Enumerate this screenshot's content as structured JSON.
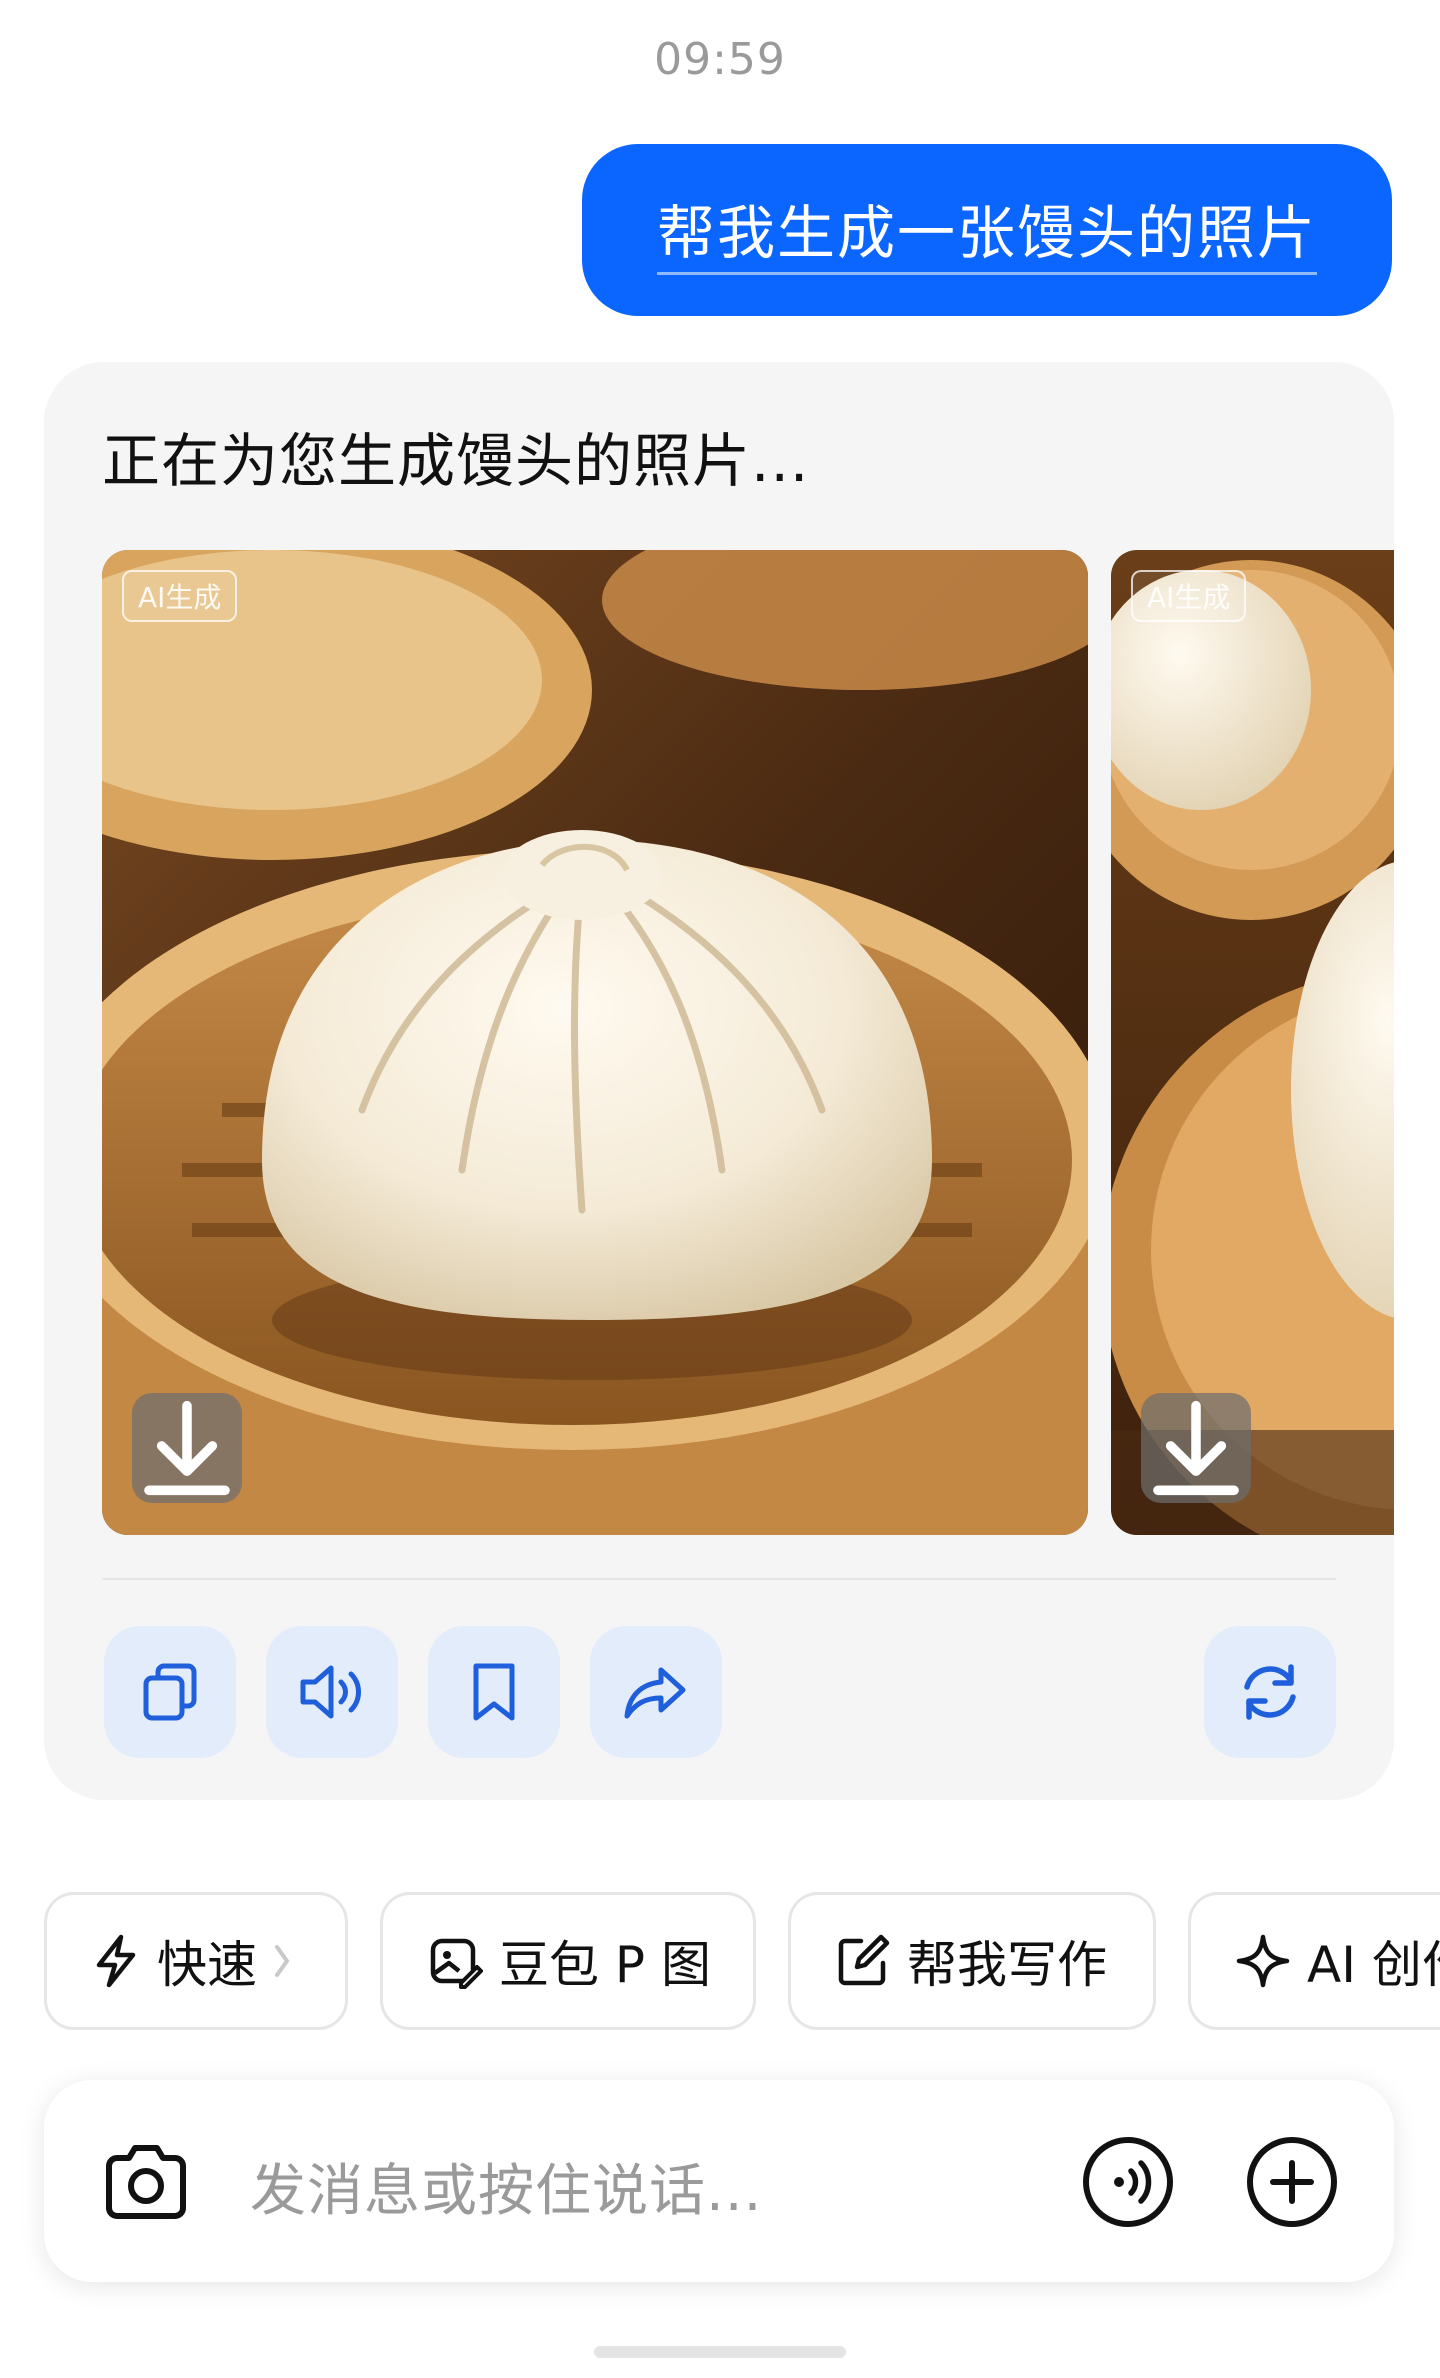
{
  "timestamp": "09:59",
  "user_message": "帮我生成一张馒头的照片",
  "ai_reply": {
    "text": "正在为您生成馒头的照片...",
    "images": [
      {
        "tag": "AI生成",
        "icon": "download-icon"
      },
      {
        "tag": "AI生成",
        "icon": "download-icon"
      }
    ],
    "actions": [
      {
        "name": "copy",
        "icon": "copy-icon"
      },
      {
        "name": "read-aloud",
        "icon": "speaker-icon"
      },
      {
        "name": "bookmark",
        "icon": "bookmark-icon"
      },
      {
        "name": "share",
        "icon": "share-icon"
      },
      {
        "name": "regenerate",
        "icon": "refresh-icon"
      }
    ]
  },
  "quick_chips": [
    {
      "label": "快速",
      "icon": "lightning-icon",
      "has_chevron": true
    },
    {
      "label": "豆包 P 图",
      "icon": "image-edit-icon"
    },
    {
      "label": "帮我写作",
      "icon": "edit-icon"
    },
    {
      "label": "AI 创作",
      "icon": "sparkle-icon"
    }
  ],
  "input": {
    "placeholder": "发消息或按住说话...",
    "left_icon": "camera-icon",
    "right_icons": [
      "voice-call-icon",
      "add-icon"
    ]
  },
  "colors": {
    "accent": "#0a66ff",
    "action_bg": "#e2ecfb",
    "icon_blue": "#1f5fdc",
    "card_bg": "#f5f5f5"
  }
}
